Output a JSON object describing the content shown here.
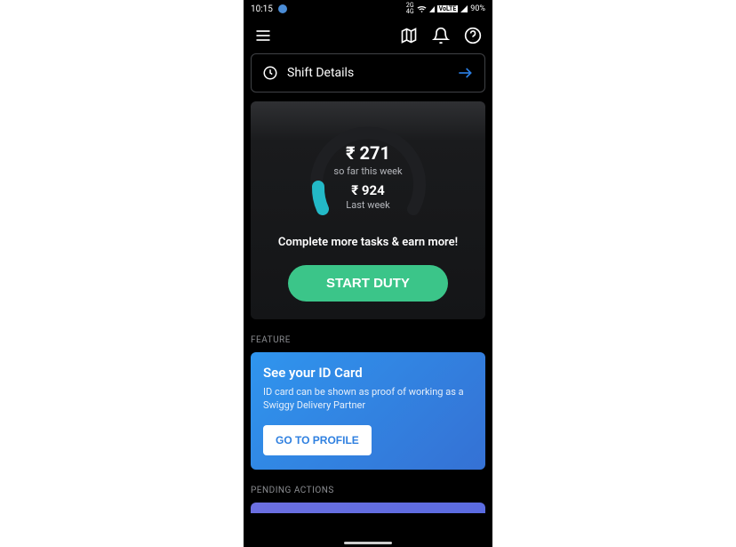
{
  "status": {
    "time": "10:15",
    "volte": "VoLTE",
    "battery": "90%"
  },
  "shift": {
    "label": "Shift Details"
  },
  "earnings": {
    "current_amount": "₹ 271",
    "current_label": "so far this week",
    "last_amount": "₹ 924",
    "last_label": "Last week",
    "prompt": "Complete more tasks & earn more!",
    "start_button": "START DUTY"
  },
  "sections": {
    "feature": "FEATURE",
    "pending": "PENDING ACTIONS"
  },
  "feature_card": {
    "title": "See your ID Card",
    "desc": "ID card can be shown as proof of working as a Swiggy Delivery Partner",
    "button": "GO TO PROFILE"
  }
}
